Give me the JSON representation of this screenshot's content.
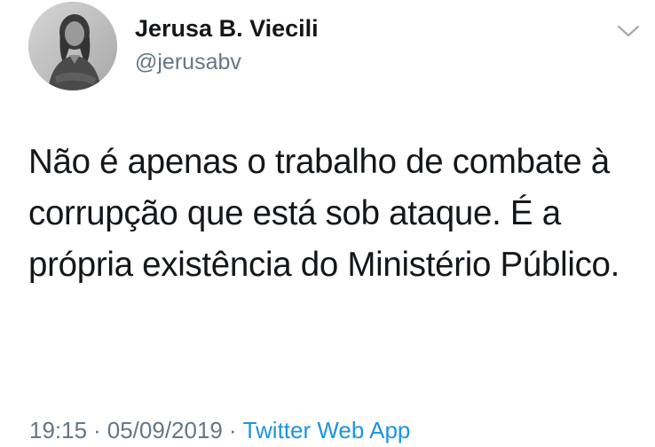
{
  "author": {
    "display_name": "Jerusa B. Viecili",
    "handle": "@jerusabv"
  },
  "tweet": {
    "text": "Não é apenas o trabalho de combate à corrupção que está sob ataque. É a própria existência do Ministério Público.",
    "time": "19:15",
    "date": "05/09/2019",
    "separator": "·",
    "source": "Twitter Web App"
  },
  "icons": {
    "avatar": "profile-photo",
    "caret": "chevron-down-icon"
  },
  "colors": {
    "text": "#14171a",
    "secondary": "#657786",
    "link": "#1b95e0"
  }
}
